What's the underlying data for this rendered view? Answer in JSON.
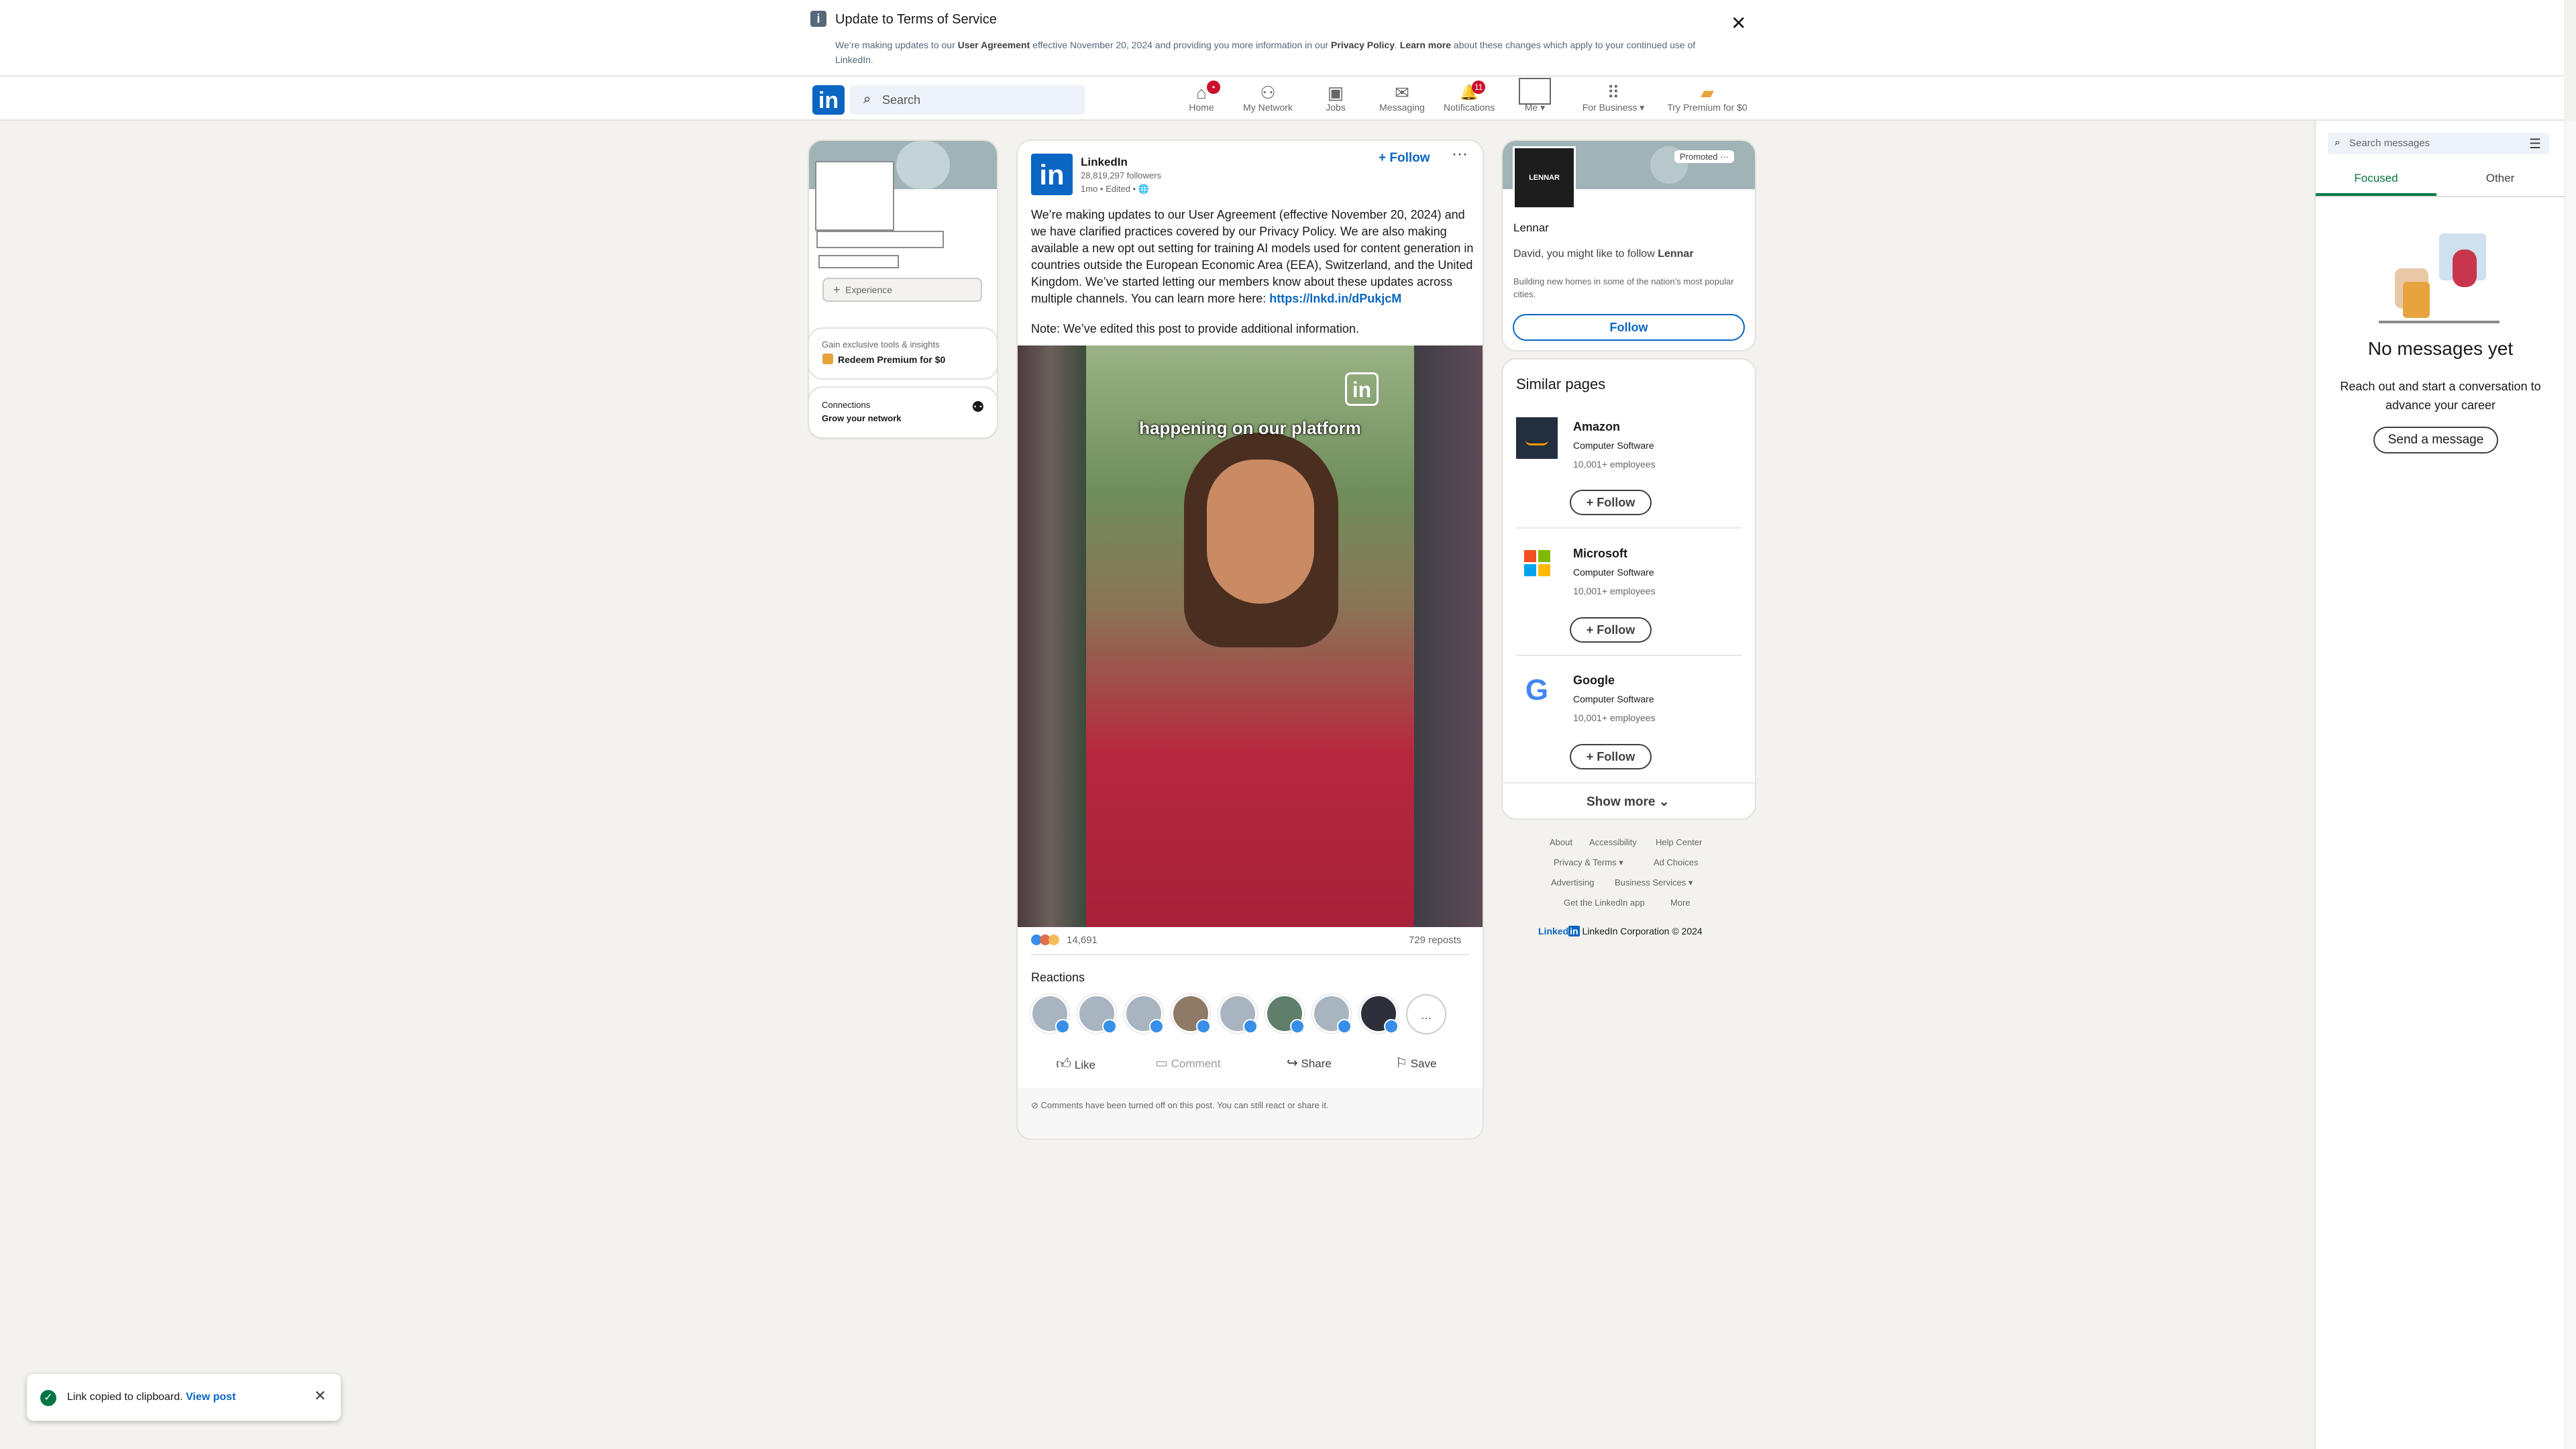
{
  "notice": {
    "title": "Update to Terms of Service",
    "body_1": "We’re making updates to our ",
    "body_link_1": "User Agreement",
    "body_2": " effective November 20, 2024 and providing you more information in our ",
    "body_link_2": "Privacy Policy",
    "body_3": ". ",
    "body_link_3": "Learn more",
    "body_4": " about these changes which apply to your continued use of LinkedIn."
  },
  "nav": {
    "logo": "in",
    "search_placeholder": "Search",
    "items": [
      {
        "label": "Home",
        "icon": "home-icon",
        "glyph": "⌂",
        "badge": "•"
      },
      {
        "label": "My Network",
        "icon": "network-icon",
        "glyph": "⚇"
      },
      {
        "label": "Jobs",
        "icon": "briefcase-icon",
        "glyph": "▣"
      },
      {
        "label": "Messaging",
        "icon": "chat-icon",
        "glyph": "✉"
      },
      {
        "label": "Notifications",
        "icon": "bell-icon",
        "glyph": "🔔",
        "badge": "11"
      },
      {
        "label": "Me ▾",
        "icon": "avatar-icon",
        "glyph": ""
      },
      {
        "label": "For Business ▾",
        "icon": "grid-icon",
        "glyph": "⠿"
      },
      {
        "label": "Try Premium for $0",
        "icon": "premium-icon",
        "glyph": "▰"
      }
    ]
  },
  "left": {
    "experience_label": "Experience",
    "premium_line": "Gain exclusive tools & insights",
    "premium_cta": "Redeem Premium for $0",
    "connections_label": "Connections",
    "connections_cta": "Grow your network"
  },
  "post": {
    "author": "LinkedIn",
    "followers": "28,819,297 followers",
    "meta": "1mo • Edited •",
    "follow_label": "+ Follow",
    "text": "We’re making updates to our User Agreement (effective November 20, 2024) and we have clarified practices covered by our Privacy Policy. We are also making available a new opt out setting for training AI models used for content generation in countries outside the European Economic Area (EEA), Switzerland, and the United Kingdom. We’ve started letting our members know about these updates across multiple channels. You can learn more here: ",
    "link": "https://lnkd.in/dPukjcM",
    "note": "Note: We’ve edited this post to provide additional information.",
    "video_caption": "happening on our platform",
    "reactions_count": "14,691",
    "reposts": "729 reposts",
    "reactions_heading": "Reactions",
    "more_reactors": "...",
    "actions": {
      "like": "Like",
      "comment": "Comment",
      "share": "Share",
      "save": "Save"
    },
    "comments_off": "Comments have been turned off on this post. You can still react or share it."
  },
  "ad": {
    "promoted": "Promoted",
    "logo_text": "LENNAR",
    "company": "Lennar",
    "line_prefix": "David, you might like to follow ",
    "line_company": "Lennar",
    "description": "Building new homes in some of the nation’s most popular cities.",
    "follow_label": "Follow"
  },
  "similar": {
    "heading": "Similar pages",
    "pages": [
      {
        "name": "Amazon",
        "industry": "Computer Software",
        "employees": "10,001+ employees",
        "follow": "Follow"
      },
      {
        "name": "Microsoft",
        "industry": "Computer Software",
        "employees": "10,001+ employees",
        "follow": "Follow"
      },
      {
        "name": "Google",
        "industry": "Computer Software",
        "employees": "10,001+ employees",
        "follow": "Follow"
      }
    ],
    "show_more": "Show more"
  },
  "footer": {
    "links_row1": [
      "About",
      "Accessibility",
      "Help Center"
    ],
    "links_row2": [
      "Privacy & Terms ▾",
      "Ad Choices"
    ],
    "links_row3": [
      "Advertising",
      "Business Services ▾"
    ],
    "links_row4": [
      "Get the LinkedIn app",
      "More"
    ],
    "brand": "Linked",
    "brand_in": "in",
    "copyright": "LinkedIn Corporation © 2024"
  },
  "messaging": {
    "search_placeholder": "Search messages",
    "tabs": [
      "Focused",
      "Other"
    ],
    "empty_title": "No messages yet",
    "empty_body": "Reach out and start a conversation to advance your career",
    "cta": "Send a message"
  },
  "toast": {
    "message": "Link copied to clipboard.",
    "link": "View post"
  },
  "colors": {
    "brand": "#0a66c2",
    "badge": "#cb112d",
    "success": "#057642"
  }
}
